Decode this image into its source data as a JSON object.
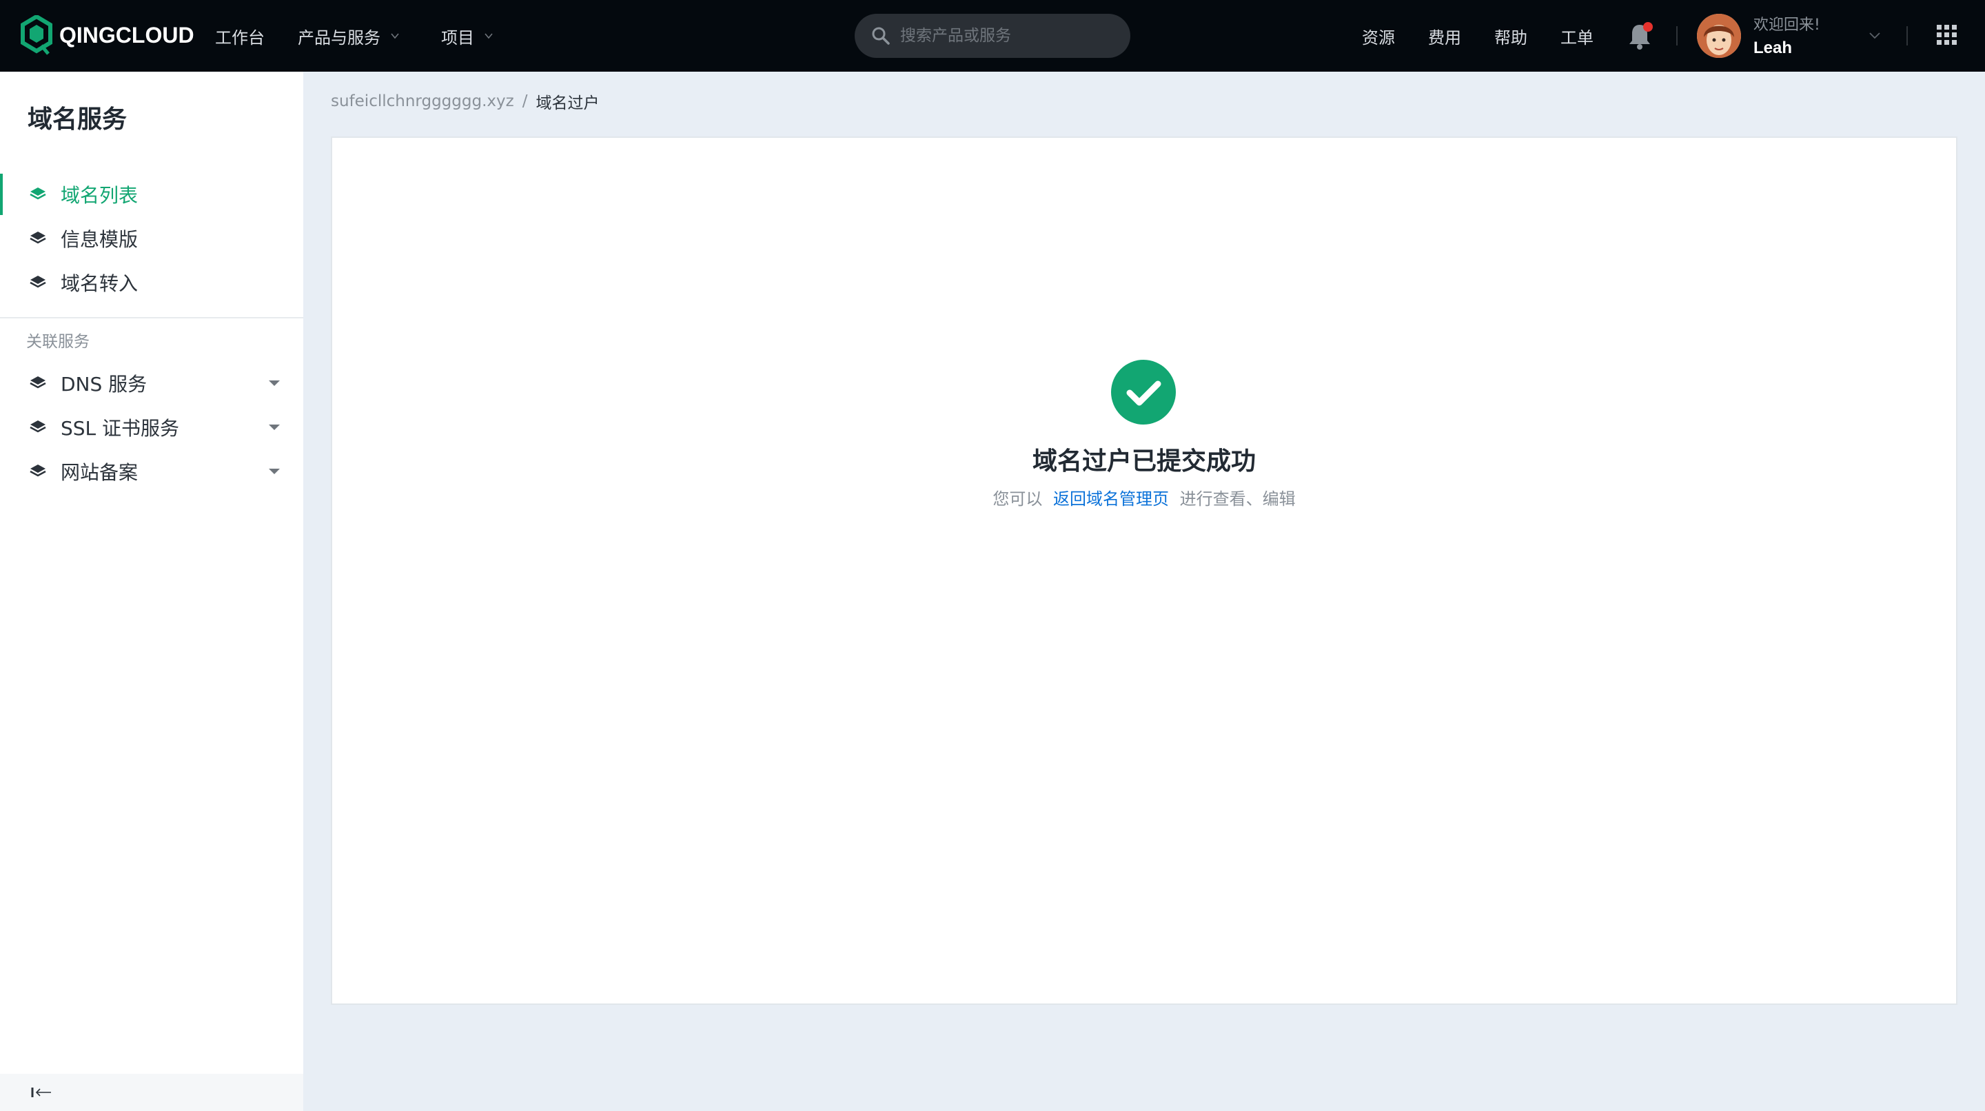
{
  "brand": {
    "name": "QINGCLOUD",
    "accent": "#12a672"
  },
  "topnav": {
    "items": [
      {
        "label": "工作台"
      },
      {
        "label": "产品与服务"
      },
      {
        "label": "项目"
      }
    ],
    "search_placeholder": "搜索产品或服务",
    "right_links": [
      {
        "label": "资源"
      },
      {
        "label": "费用"
      },
      {
        "label": "帮助"
      },
      {
        "label": "工单"
      }
    ],
    "welcome": "欢迎回来!",
    "username": "Leah"
  },
  "sidebar": {
    "title": "域名服务",
    "items": [
      {
        "label": "域名列表",
        "active": true
      },
      {
        "label": "信息模版"
      },
      {
        "label": "域名转入"
      }
    ],
    "section_label": "关联服务",
    "related": [
      {
        "label": "DNS 服务"
      },
      {
        "label": "SSL 证书服务"
      },
      {
        "label": "网站备案"
      }
    ]
  },
  "breadcrumb": {
    "parent": "sufeicllchnrgggggg.xyz",
    "separator": "/",
    "current": "域名过户"
  },
  "result": {
    "title": "域名过户已提交成功",
    "desc_prefix": "您可以",
    "link": "返回域名管理页",
    "desc_suffix": "进行查看、编辑"
  }
}
